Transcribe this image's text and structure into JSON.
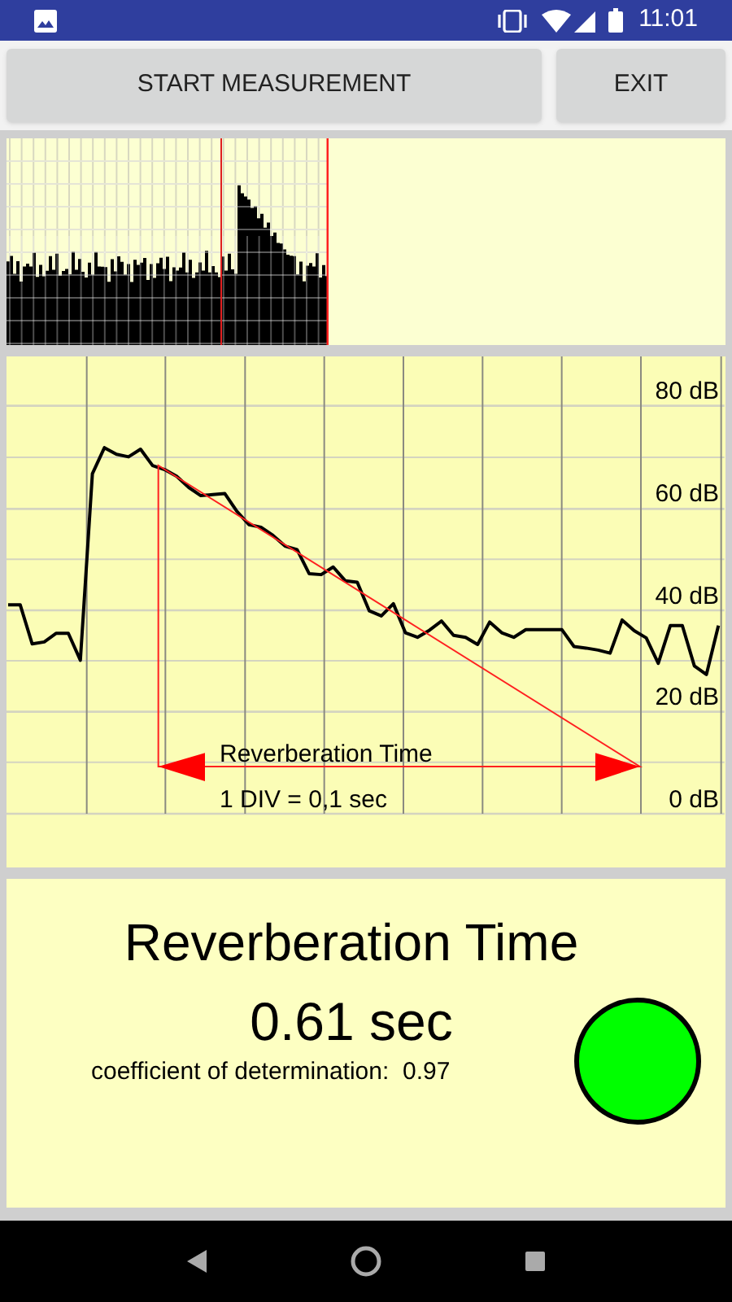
{
  "status_bar": {
    "time": "11:01"
  },
  "buttons": [
    {
      "label": "START MEASUREMENT"
    },
    {
      "label": "EXIT"
    }
  ],
  "decay_plot": {
    "annotation": "Reverberation Time",
    "scale_note": "1 DIV = 0,1 sec",
    "chart_data": {
      "type": "line",
      "ylim": [
        0,
        89.7
      ],
      "grid": true,
      "yticks": [
        {
          "value": 80,
          "label": "80 dB"
        },
        {
          "value": 60,
          "label": "60 dB"
        },
        {
          "value": 40,
          "label": "40 dB"
        },
        {
          "value": 20,
          "label": "20 dB"
        },
        {
          "value": 0,
          "label": "0 dB"
        }
      ],
      "categories": [
        null,
        null,
        null,
        null,
        null,
        null,
        null,
        null,
        null,
        null,
        null,
        null,
        null,
        null,
        null,
        null,
        null,
        null,
        null,
        null,
        null,
        null,
        null,
        null,
        null,
        null,
        null,
        null,
        null,
        null,
        null,
        null,
        null,
        null,
        null,
        null,
        null,
        null,
        null,
        null,
        null,
        null,
        null,
        null,
        null,
        null,
        null,
        null,
        null,
        null,
        null,
        null,
        null,
        null,
        null,
        null,
        null,
        null,
        null,
        null
      ],
      "series": [
        {
          "color": "#000000",
          "values": [
            41.0,
            41.0,
            33.3,
            33.7,
            35.4,
            35.4,
            30.1,
            66.7,
            71.8,
            70.5,
            70.0,
            71.5,
            68.3,
            67.5,
            66.2,
            64.0,
            62.4,
            62.6,
            62.8,
            59.3,
            56.7,
            56.2,
            54.6,
            52.5,
            51.8,
            47.1,
            46.9,
            48.4,
            45.7,
            45.4,
            39.8,
            38.8,
            41.2,
            35.5,
            34.6,
            36.0,
            37.8,
            35.0,
            34.6,
            33.2,
            37.6,
            35.5,
            34.6,
            36.1,
            36.1,
            36.1,
            36.1,
            32.8,
            32.5,
            32.1,
            31.5,
            38.0,
            35.9,
            34.5,
            29.5,
            36.9,
            36.9,
            29.0,
            27.3,
            36.9
          ]
        }
      ]
    }
  },
  "result": {
    "title": "Reverberation Time",
    "value": "0.61 sec",
    "determination": "coefficient of determination:  0.97",
    "passed": true
  }
}
